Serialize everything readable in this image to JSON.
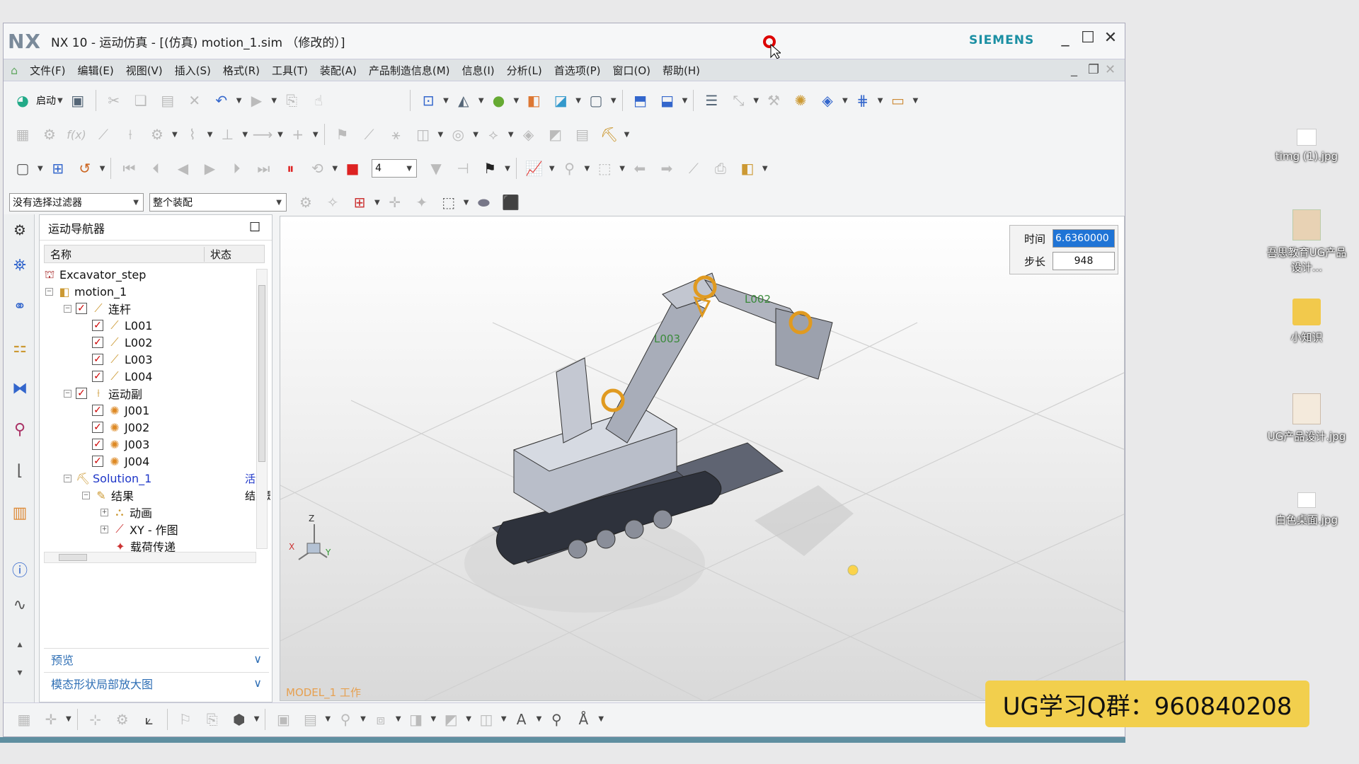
{
  "window": {
    "logo": "NX",
    "title": "NX 10 - 运动仿真 - [(仿真) motion_1.sim （修改的）]",
    "brand": "SIEMENS",
    "min": "_",
    "max": "☐",
    "close": "✕"
  },
  "menus": [
    "文件(F)",
    "编辑(E)",
    "视图(V)",
    "插入(S)",
    "格式(R)",
    "工具(T)",
    "装配(A)",
    "产品制造信息(M)",
    "信息(I)",
    "分析(L)",
    "首选项(P)",
    "窗口(O)",
    "帮助(H)"
  ],
  "toolbar": {
    "start": "启动",
    "step_value": "4"
  },
  "filters": {
    "selection_filter": "没有选择过滤器",
    "scope": "整个装配"
  },
  "navigator": {
    "title": "运动导航器",
    "col_name": "名称",
    "col_status": "状态",
    "rows": [
      {
        "label": "Excavator_step",
        "status": ""
      },
      {
        "label": "motion_1",
        "status": ""
      },
      {
        "label": "连杆",
        "status": ""
      },
      {
        "label": "L001",
        "status": ""
      },
      {
        "label": "L002",
        "status": ""
      },
      {
        "label": "L003",
        "status": ""
      },
      {
        "label": "L004",
        "status": ""
      },
      {
        "label": "运动副",
        "status": ""
      },
      {
        "label": "J001",
        "status": ""
      },
      {
        "label": "J002",
        "status": ""
      },
      {
        "label": "J003",
        "status": ""
      },
      {
        "label": "J004",
        "status": ""
      },
      {
        "label": "Solution_1",
        "status": "活动"
      },
      {
        "label": "结果",
        "status": "结果是最"
      },
      {
        "label": "动画",
        "status": ""
      },
      {
        "label": "XY - 作图",
        "status": ""
      },
      {
        "label": "载荷传递",
        "status": ""
      }
    ],
    "preview": "预览",
    "mode_shape": "模态形状局部放大图"
  },
  "viewport": {
    "time_label": "时间",
    "time_value": "6.6360000",
    "step_label": "步长",
    "step_value": "948",
    "labels": {
      "l002": "L002",
      "l003": "L003",
      "model": "MODEL_1 工作"
    },
    "axes": {
      "x": "X",
      "y": "Y",
      "z": "Z"
    }
  },
  "desktop": [
    {
      "label": "timg (1).jpg"
    },
    {
      "label": "吾思教育UG产品设计..."
    },
    {
      "label": "小知识"
    },
    {
      "label": "UG产品设计.jpg"
    },
    {
      "label": "白色桌面.jpg"
    }
  ],
  "overlay": {
    "qq_group": "UG学习Q群：960840208"
  }
}
